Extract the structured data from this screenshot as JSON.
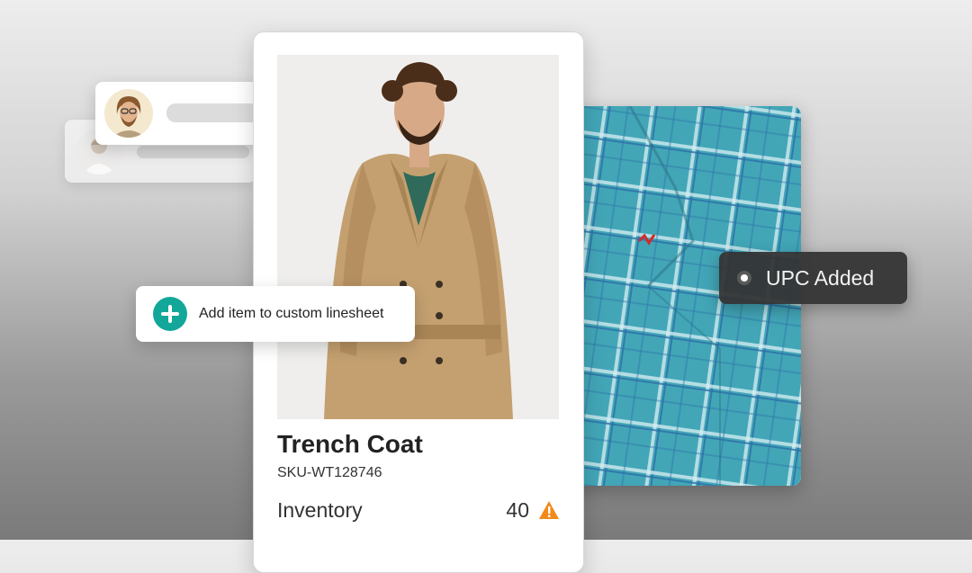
{
  "product": {
    "name": "Trench Coat",
    "sku": "SKU-WT128746",
    "inventory_label": "Inventory",
    "inventory_value": "40",
    "warning_icon": "warning-triangle-icon"
  },
  "actions": {
    "add_item_label": "Add item to custom linesheet",
    "add_icon": "plus-circle-icon"
  },
  "badges": {
    "upc_label": "UPC Added",
    "upc_icon": "radio-dot-icon"
  },
  "colors": {
    "accent": "#13a79a",
    "warning": "#f08a1c",
    "badge_bg": "#343434",
    "coat": "#c4a070",
    "jacket": "#3e9fb2"
  }
}
